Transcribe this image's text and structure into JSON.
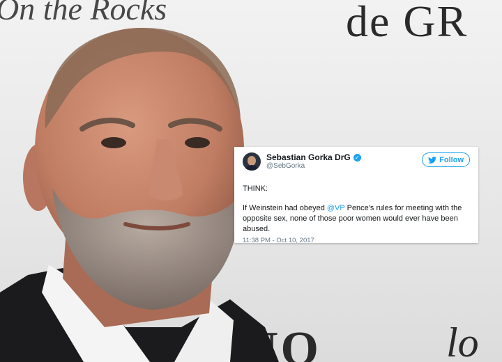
{
  "backdrop": {
    "text_top_left": "On the Rocks",
    "text_top_right": "de GR",
    "text_bottom_mid": "NO",
    "text_bottom_right": "lo"
  },
  "tweet": {
    "display_name": "Sebastian Gorka DrG",
    "handle": "@SebGorka",
    "verified_icon": "verified-badge-icon",
    "follow_label": "Follow",
    "line1": "THINK:",
    "body_before_mention": "If Weinstein had obeyed ",
    "mention": "@VP",
    "body_after_mention": " Pence's rules for meeting with the opposite sex, none of those poor women would ever have been abused.",
    "timestamp": "11:38 PM - Oct 10, 2017"
  },
  "colors": {
    "twitter_blue": "#1da1f2",
    "text_dark": "#14171a",
    "text_gray": "#657786"
  }
}
